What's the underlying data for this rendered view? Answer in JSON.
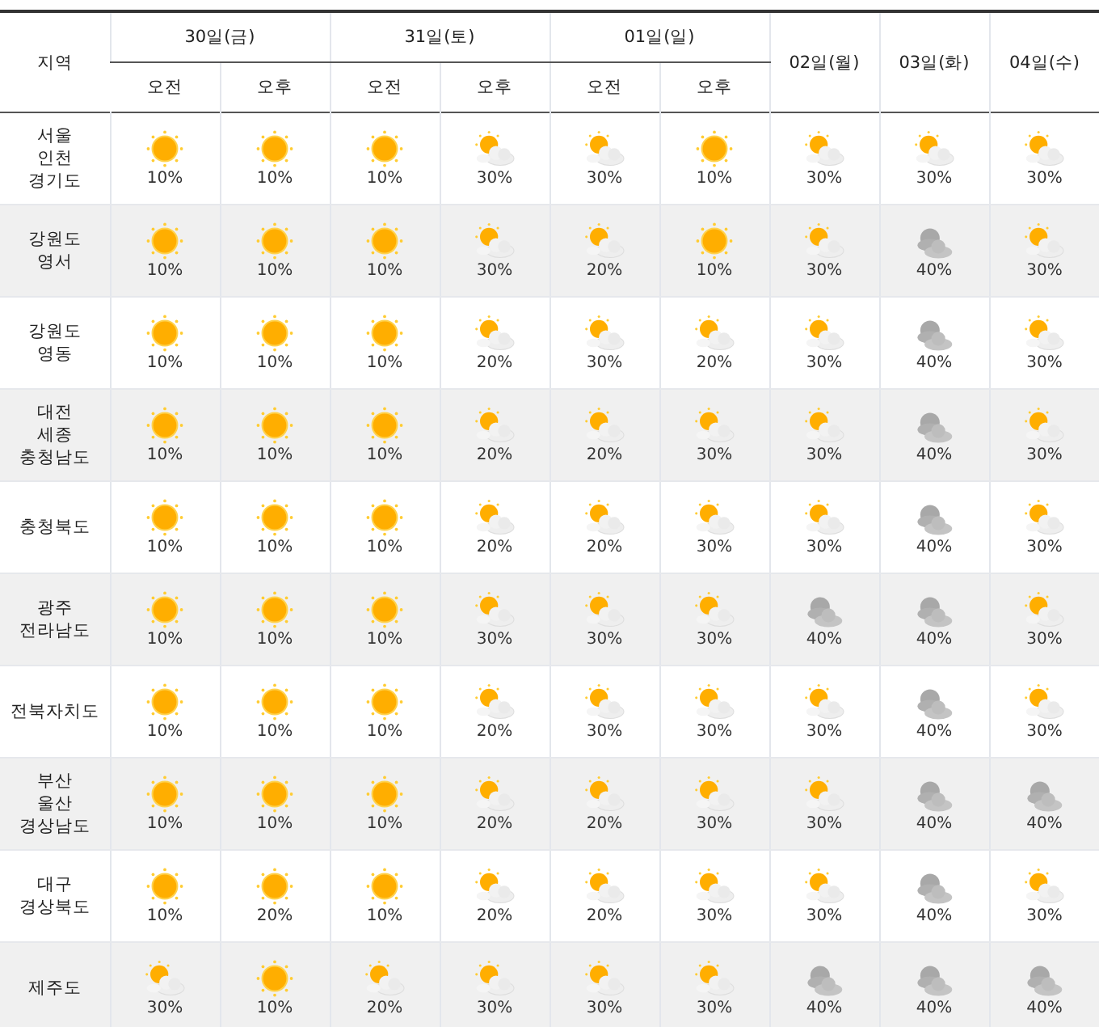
{
  "header": {
    "region": "지역",
    "days": [
      {
        "label": "30일(금)",
        "periods": [
          "오전",
          "오후"
        ]
      },
      {
        "label": "31일(토)",
        "periods": [
          "오전",
          "오후"
        ]
      },
      {
        "label": "01일(일)",
        "periods": [
          "오전",
          "오후"
        ]
      },
      {
        "label": "02일(월)"
      },
      {
        "label": "03일(화)"
      },
      {
        "label": "04일(수)"
      }
    ]
  },
  "rows": [
    {
      "region": "서울\n인천\n경기도",
      "cells": [
        {
          "kind": "sunny",
          "rain": "10%"
        },
        {
          "kind": "sunny",
          "rain": "10%"
        },
        {
          "kind": "sunny",
          "rain": "10%"
        },
        {
          "kind": "partly",
          "rain": "30%"
        },
        {
          "kind": "partly",
          "rain": "30%"
        },
        {
          "kind": "sunny",
          "rain": "10%"
        },
        {
          "kind": "partly",
          "rain": "30%"
        },
        {
          "kind": "partly",
          "rain": "30%"
        },
        {
          "kind": "partly",
          "rain": "30%"
        }
      ]
    },
    {
      "region": "강원도\n영서",
      "cells": [
        {
          "kind": "sunny",
          "rain": "10%"
        },
        {
          "kind": "sunny",
          "rain": "10%"
        },
        {
          "kind": "sunny",
          "rain": "10%"
        },
        {
          "kind": "partly",
          "rain": "30%"
        },
        {
          "kind": "partly",
          "rain": "20%"
        },
        {
          "kind": "sunny",
          "rain": "10%"
        },
        {
          "kind": "partly",
          "rain": "30%"
        },
        {
          "kind": "cloudy",
          "rain": "40%"
        },
        {
          "kind": "partly",
          "rain": "30%"
        }
      ]
    },
    {
      "region": "강원도\n영동",
      "cells": [
        {
          "kind": "sunny",
          "rain": "10%"
        },
        {
          "kind": "sunny",
          "rain": "10%"
        },
        {
          "kind": "sunny",
          "rain": "10%"
        },
        {
          "kind": "partly",
          "rain": "20%"
        },
        {
          "kind": "partly",
          "rain": "30%"
        },
        {
          "kind": "partly",
          "rain": "20%"
        },
        {
          "kind": "partly",
          "rain": "30%"
        },
        {
          "kind": "cloudy",
          "rain": "40%"
        },
        {
          "kind": "partly",
          "rain": "30%"
        }
      ]
    },
    {
      "region": "대전\n세종\n충청남도",
      "cells": [
        {
          "kind": "sunny",
          "rain": "10%"
        },
        {
          "kind": "sunny",
          "rain": "10%"
        },
        {
          "kind": "sunny",
          "rain": "10%"
        },
        {
          "kind": "partly",
          "rain": "20%"
        },
        {
          "kind": "partly",
          "rain": "20%"
        },
        {
          "kind": "partly",
          "rain": "30%"
        },
        {
          "kind": "partly",
          "rain": "30%"
        },
        {
          "kind": "cloudy",
          "rain": "40%"
        },
        {
          "kind": "partly",
          "rain": "30%"
        }
      ]
    },
    {
      "region": "충청북도",
      "cells": [
        {
          "kind": "sunny",
          "rain": "10%"
        },
        {
          "kind": "sunny",
          "rain": "10%"
        },
        {
          "kind": "sunny",
          "rain": "10%"
        },
        {
          "kind": "partly",
          "rain": "20%"
        },
        {
          "kind": "partly",
          "rain": "20%"
        },
        {
          "kind": "partly",
          "rain": "30%"
        },
        {
          "kind": "partly",
          "rain": "30%"
        },
        {
          "kind": "cloudy",
          "rain": "40%"
        },
        {
          "kind": "partly",
          "rain": "30%"
        }
      ]
    },
    {
      "region": "광주\n전라남도",
      "cells": [
        {
          "kind": "sunny",
          "rain": "10%"
        },
        {
          "kind": "sunny",
          "rain": "10%"
        },
        {
          "kind": "sunny",
          "rain": "10%"
        },
        {
          "kind": "partly",
          "rain": "30%"
        },
        {
          "kind": "partly",
          "rain": "30%"
        },
        {
          "kind": "partly",
          "rain": "30%"
        },
        {
          "kind": "cloudy",
          "rain": "40%"
        },
        {
          "kind": "cloudy",
          "rain": "40%"
        },
        {
          "kind": "partly",
          "rain": "30%"
        }
      ]
    },
    {
      "region": "전북자치도",
      "cells": [
        {
          "kind": "sunny",
          "rain": "10%"
        },
        {
          "kind": "sunny",
          "rain": "10%"
        },
        {
          "kind": "sunny",
          "rain": "10%"
        },
        {
          "kind": "partly",
          "rain": "20%"
        },
        {
          "kind": "partly",
          "rain": "30%"
        },
        {
          "kind": "partly",
          "rain": "30%"
        },
        {
          "kind": "partly",
          "rain": "30%"
        },
        {
          "kind": "cloudy",
          "rain": "40%"
        },
        {
          "kind": "partly",
          "rain": "30%"
        }
      ]
    },
    {
      "region": "부산\n울산\n경상남도",
      "cells": [
        {
          "kind": "sunny",
          "rain": "10%"
        },
        {
          "kind": "sunny",
          "rain": "10%"
        },
        {
          "kind": "sunny",
          "rain": "10%"
        },
        {
          "kind": "partly",
          "rain": "20%"
        },
        {
          "kind": "partly",
          "rain": "20%"
        },
        {
          "kind": "partly",
          "rain": "30%"
        },
        {
          "kind": "partly",
          "rain": "30%"
        },
        {
          "kind": "cloudy",
          "rain": "40%"
        },
        {
          "kind": "cloudy",
          "rain": "40%"
        }
      ]
    },
    {
      "region": "대구\n경상북도",
      "cells": [
        {
          "kind": "sunny",
          "rain": "10%"
        },
        {
          "kind": "sunny",
          "rain": "20%"
        },
        {
          "kind": "sunny",
          "rain": "10%"
        },
        {
          "kind": "partly",
          "rain": "20%"
        },
        {
          "kind": "partly",
          "rain": "20%"
        },
        {
          "kind": "partly",
          "rain": "30%"
        },
        {
          "kind": "partly",
          "rain": "30%"
        },
        {
          "kind": "cloudy",
          "rain": "40%"
        },
        {
          "kind": "partly",
          "rain": "30%"
        }
      ]
    },
    {
      "region": "제주도",
      "cells": [
        {
          "kind": "partly",
          "rain": "30%"
        },
        {
          "kind": "sunny",
          "rain": "10%"
        },
        {
          "kind": "partly",
          "rain": "20%"
        },
        {
          "kind": "partly",
          "rain": "30%"
        },
        {
          "kind": "partly",
          "rain": "30%"
        },
        {
          "kind": "partly",
          "rain": "30%"
        },
        {
          "kind": "cloudy",
          "rain": "40%"
        },
        {
          "kind": "cloudy",
          "rain": "40%"
        },
        {
          "kind": "cloudy",
          "rain": "40%"
        }
      ]
    }
  ]
}
